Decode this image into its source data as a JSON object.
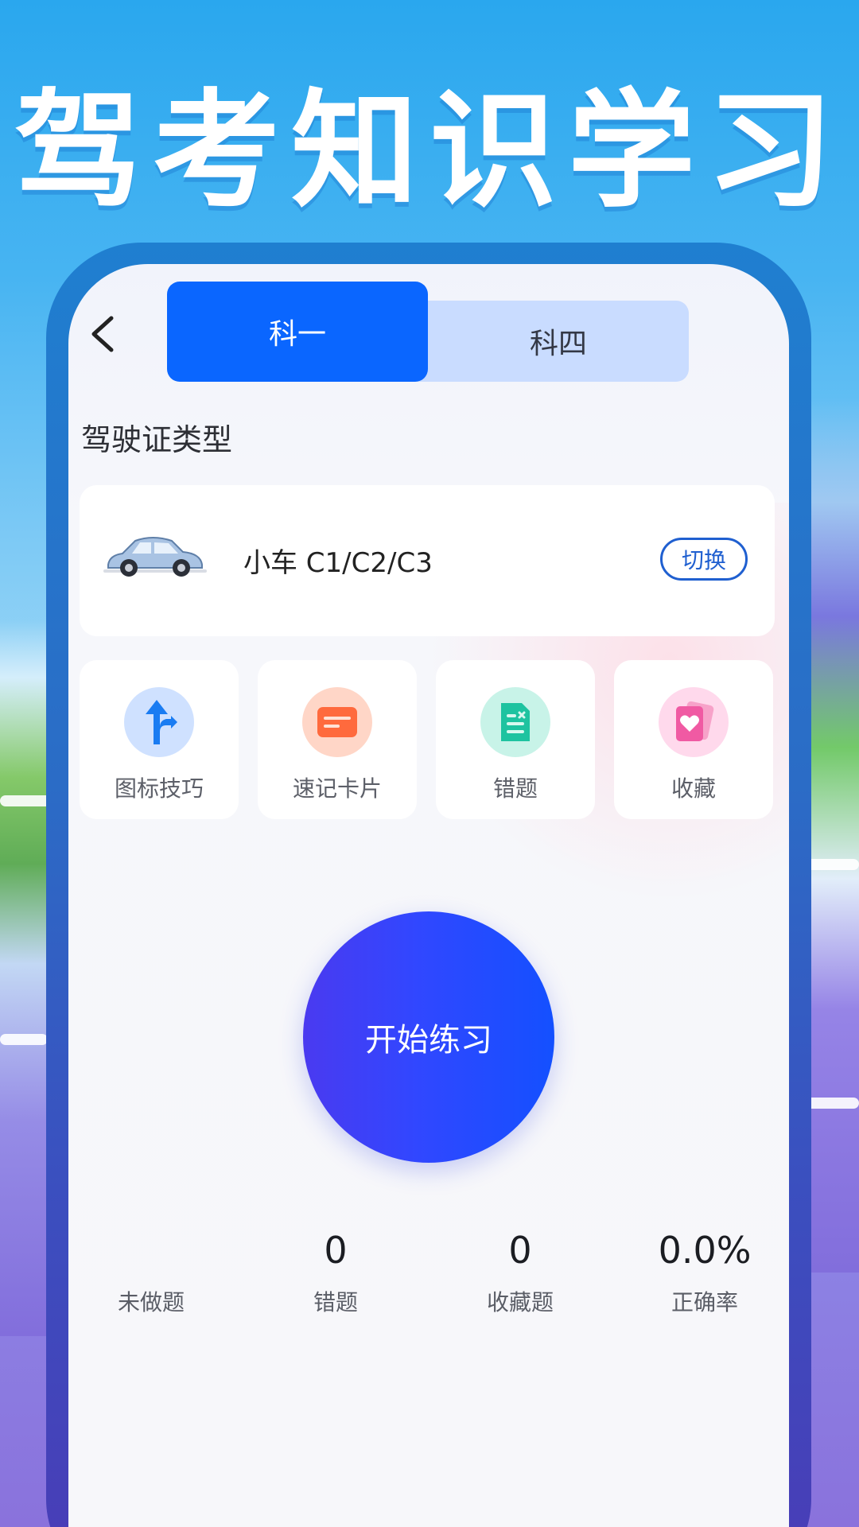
{
  "headline": "驾考知识学习",
  "tabs": [
    {
      "label": "科一",
      "active": true
    },
    {
      "label": "科四",
      "active": false
    }
  ],
  "license_section": {
    "title": "驾驶证类型",
    "vehicle": "小车 C1/C2/C3",
    "switch_label": "切换"
  },
  "features": [
    {
      "label": "图标技巧",
      "icon": "road-sign-icon",
      "color": "#1a7cf2"
    },
    {
      "label": "速记卡片",
      "icon": "card-icon",
      "color": "#ff6a3d"
    },
    {
      "label": "错题",
      "icon": "document-icon",
      "color": "#1ec3a0"
    },
    {
      "label": "收藏",
      "icon": "heart-card-icon",
      "color": "#f05aa3"
    }
  ],
  "start_button": "开始练习",
  "stats": [
    {
      "value": "",
      "label": "未做题"
    },
    {
      "value": "0",
      "label": "错题"
    },
    {
      "value": "0",
      "label": "收藏题"
    },
    {
      "value": "0.0%",
      "label": "正确率"
    }
  ],
  "colors": {
    "accent": "#0a66ff",
    "tab_inactive_bg": "#c9dcff"
  }
}
